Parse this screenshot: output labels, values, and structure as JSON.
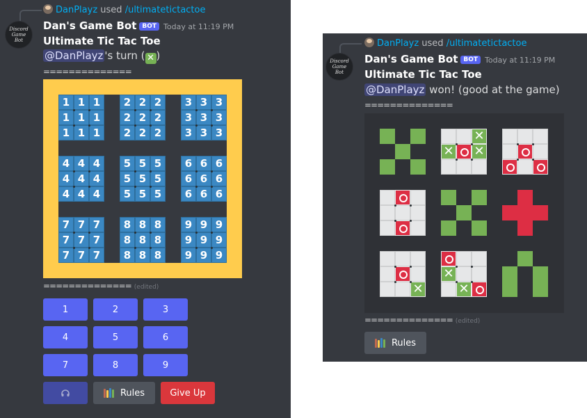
{
  "left": {
    "reply": {
      "user": "DanPlayz",
      "verb": "used",
      "command": "/ultimatetictactoe"
    },
    "author": {
      "name": "Dan's Game Bot",
      "badge": "BOT",
      "timestamp": "Today at 11:19 PM",
      "avatar_text": [
        "Discord",
        "Game",
        "Bot"
      ]
    },
    "title": "Ultimate Tic Tac Toe",
    "status": {
      "mention": "@DanPlayz",
      "text_before_emoji": "'s turn (",
      "emoji": "✕",
      "text_after_emoji": ")"
    },
    "divider_top": "==============",
    "divider_bottom": "==============",
    "edited": "(edited)",
    "board": {
      "subgrids": [
        [
          "1",
          "1",
          "1",
          "1",
          "1",
          "1",
          "1",
          "1",
          "1"
        ],
        [
          "2",
          "2",
          "2",
          "2",
          "2",
          "2",
          "2",
          "2",
          "2"
        ],
        [
          "3",
          "3",
          "3",
          "3",
          "3",
          "3",
          "3",
          "3",
          "3"
        ],
        [
          "4",
          "4",
          "4",
          "4",
          "4",
          "4",
          "4",
          "4",
          "4"
        ],
        [
          "5",
          "5",
          "5",
          "5",
          "5",
          "5",
          "5",
          "5",
          "5"
        ],
        [
          "6",
          "6",
          "6",
          "6",
          "6",
          "6",
          "6",
          "6",
          "6"
        ],
        [
          "7",
          "7",
          "7",
          "7",
          "7",
          "7",
          "7",
          "7",
          "7"
        ],
        [
          "8",
          "8",
          "8",
          "8",
          "8",
          "8",
          "8",
          "8",
          "8"
        ],
        [
          "9",
          "9",
          "9",
          "9",
          "9",
          "9",
          "9",
          "9",
          "9"
        ]
      ]
    },
    "buttons": [
      "1",
      "2",
      "3",
      "4",
      "5",
      "6",
      "7",
      "8",
      "9"
    ],
    "actions": {
      "rules": "Rules",
      "give_up": "Give Up"
    }
  },
  "right": {
    "reply": {
      "user": "DanPlayz",
      "verb": "used",
      "command": "/ultimatetictactoe"
    },
    "author": {
      "name": "Dan's Game Bot",
      "badge": "BOT",
      "timestamp": "Today at 11:19 PM",
      "avatar_text": [
        "Discord",
        "Game",
        "Bot"
      ]
    },
    "title": "Ultimate Tic Tac Toe",
    "status": {
      "mention": "@DanPlayz",
      "text": " won! (good at the game)"
    },
    "divider_top": "==============",
    "divider_bottom": "==============",
    "edited": "(edited)",
    "board": {
      "subgrids": [
        [
          "g",
          "",
          "g",
          "",
          "g",
          "",
          "g",
          "",
          "g"
        ],
        [
          "b",
          "b",
          "X",
          "X",
          "O",
          "X",
          "b",
          "b",
          "b"
        ],
        [
          "b",
          "b",
          "b",
          "b",
          "O",
          "b",
          "O",
          "b",
          "O"
        ],
        [
          "b",
          "O",
          "b",
          "b",
          "b",
          "b",
          "b",
          "O",
          "b"
        ],
        [
          "g",
          "",
          "g",
          "",
          "g",
          "",
          "g",
          "",
          "g"
        ],
        [
          "",
          "r",
          "",
          "r",
          "r",
          "r",
          "",
          "r",
          ""
        ],
        [
          "b",
          "b",
          "b",
          "b",
          "O",
          "b",
          "b",
          "b",
          "X"
        ],
        [
          "O",
          "b",
          "b",
          "X",
          "b",
          "b",
          "b",
          "X",
          "O"
        ],
        [
          "",
          "g",
          "",
          "g",
          "",
          "g",
          "g",
          "",
          "g"
        ]
      ]
    },
    "actions": {
      "rules": "Rules"
    }
  },
  "colors": {
    "background": "#36393f",
    "blurple": "#5865f2",
    "gold": "#ffcc4d",
    "blue_cell": "#3b88c3",
    "green": "#77b255",
    "red": "#dd2e44",
    "danger": "#da373c",
    "link": "#00aff4"
  }
}
